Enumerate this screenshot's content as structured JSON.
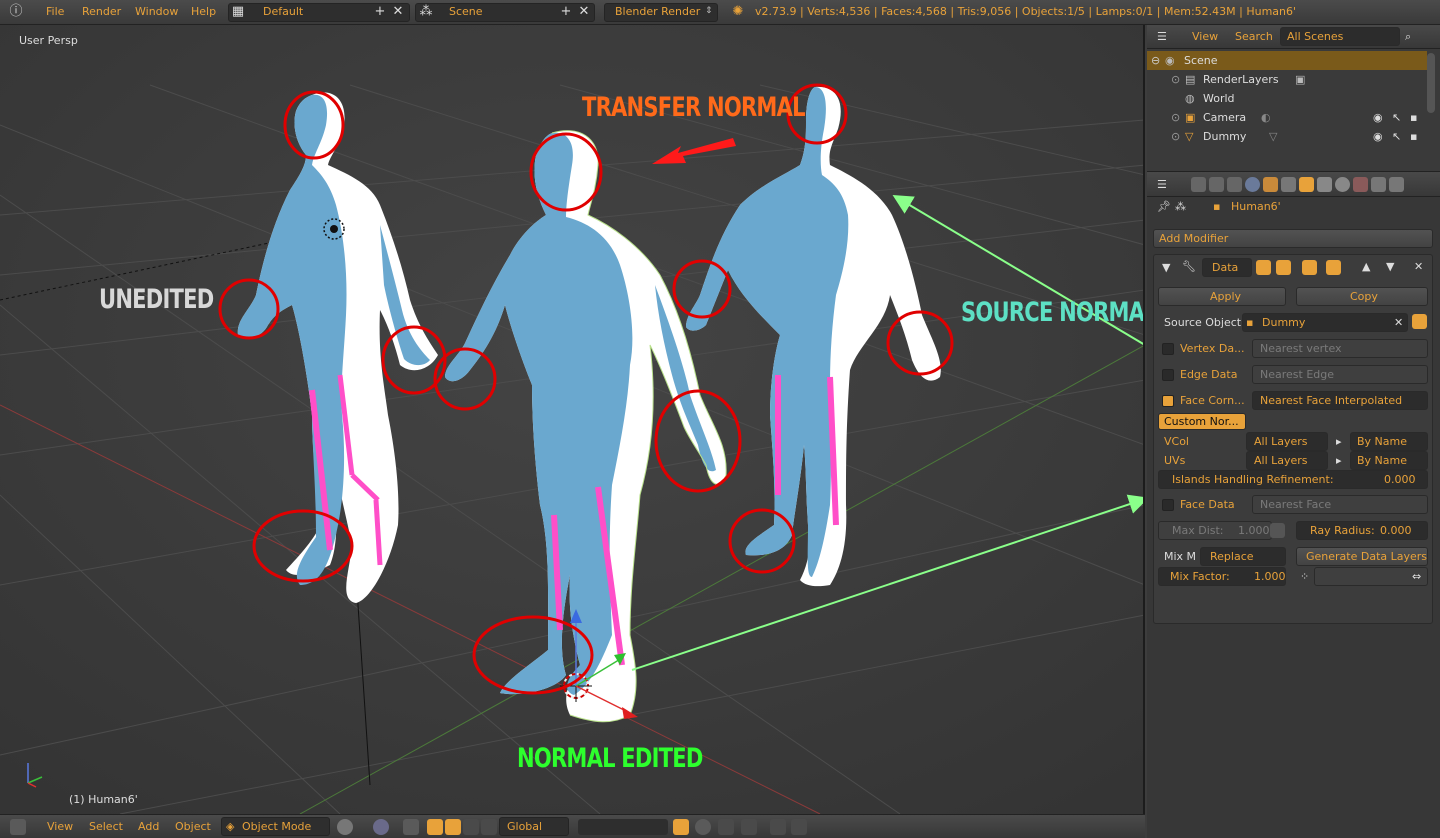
{
  "topbar": {
    "menus": [
      "File",
      "Render",
      "Window",
      "Help"
    ],
    "screen_layout": "Default",
    "scene": "Scene",
    "engine": "Blender Render",
    "stats": "v2.73.9 | Verts:4,536 | Faces:4,568 | Tris:9,056 | Objects:1/5 | Lamps:0/1 | Mem:52.43M | Human6'"
  },
  "viewport": {
    "view_name": "User Persp",
    "active_object": "(1) Human6'"
  },
  "annotations": {
    "transfer": "TRANSFER NORMAL",
    "unedited": "UNEDITED",
    "source": "SOURCE NORMAL",
    "edited": "NORMAL EDITED",
    "colors": {
      "transfer": "#ff6a1a",
      "unedited": "#d8d8d8",
      "source": "#5de0c4",
      "edited": "#2dff2d",
      "circles": "#e00000",
      "arrows": "#8aff8a",
      "figure_blue": "#6aa8cf",
      "seam": "#ff4fc8"
    }
  },
  "bottombar": {
    "menus": [
      "View",
      "Select",
      "Add",
      "Object"
    ],
    "mode": "Object Mode",
    "orientation": "Global"
  },
  "outliner": {
    "menus": [
      "View",
      "Search"
    ],
    "filter": "All Scenes",
    "tree": [
      {
        "label": "Scene",
        "icon": "scene-icon"
      },
      {
        "label": "RenderLayers",
        "icon": "renderlayers-icon"
      },
      {
        "label": "World",
        "icon": "world-icon"
      },
      {
        "label": "Camera",
        "icon": "camera-icon"
      },
      {
        "label": "Dummy",
        "icon": "mesh-icon"
      }
    ]
  },
  "properties": {
    "object_name": "Human6'",
    "add_modifier": "Add Modifier",
    "modifier_name": "Data",
    "apply": "Apply",
    "copy": "Copy",
    "source_object_label": "Source Object:",
    "source_object": "Dummy",
    "vertex_data": "Vertex Da...",
    "vertex_mode": "Nearest vertex",
    "edge_data": "Edge Data",
    "edge_mode": "Nearest Edge",
    "face_corner": "Face Corn...",
    "face_corner_mode": "Nearest Face Interpolated",
    "custom_normals": "Custom Nor...",
    "vcol": "VCol",
    "vcol_layers": "All Layers",
    "vcol_by": "By Name",
    "uvs": "UVs",
    "uvs_layers": "All Layers",
    "uvs_by": "By Name",
    "islands_label": "Islands Handling Refinement:",
    "islands_value": "0.000",
    "face_data": "Face Data",
    "face_data_mode": "Nearest Face",
    "max_dist_label": "Max Dist:",
    "max_dist_value": "1.000",
    "ray_radius_label": "Ray Radius:",
    "ray_radius_value": "0.000",
    "mix_mode_label": "Mix M",
    "mix_mode": "Replace",
    "generate": "Generate Data Layers",
    "mix_factor_label": "Mix Factor:",
    "mix_factor_value": "1.000"
  }
}
